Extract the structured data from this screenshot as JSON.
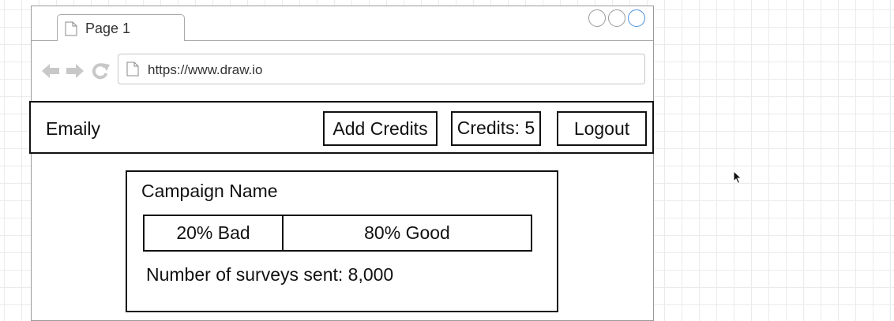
{
  "browser": {
    "tab_label": "Page 1",
    "url": "https://www.draw.io",
    "icons": {
      "page": "document-icon",
      "back": "arrow-left-icon",
      "forward": "arrow-right-icon",
      "reload": "reload-icon"
    },
    "window_controls": [
      "circle",
      "circle",
      "circle-active"
    ]
  },
  "navbar": {
    "brand": "Emaily",
    "add_credits": "Add Credits",
    "credits": "Credits: 5",
    "logout": "Logout"
  },
  "campaign": {
    "name": "Campaign Name",
    "bad_percent": 20,
    "good_percent": 80,
    "bad_label": "20% Bad",
    "good_label": "80% Good",
    "surveys_sent": "Number of surveys sent: 8,000"
  },
  "colors": {
    "outline": "#111111",
    "active_control": "#4a90d9",
    "chrome_icon": "#c8c8c8"
  }
}
